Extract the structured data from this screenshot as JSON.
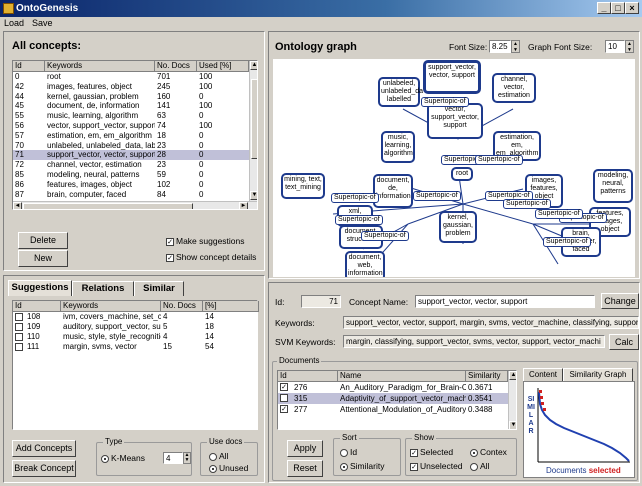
{
  "window": {
    "title": "OntoGenesis"
  },
  "menu": [
    "Load",
    "Save"
  ],
  "concepts_panel": {
    "title": "All concepts:",
    "columns": [
      "Id",
      "Keywords",
      "No. Docs",
      "Used [%]"
    ],
    "rows": [
      [
        "0",
        "root",
        "701",
        "100"
      ],
      [
        "42",
        "images, features, object",
        "245",
        "100"
      ],
      [
        "44",
        "kernel, gaussian, problem",
        "160",
        "0"
      ],
      [
        "45",
        "document, de, information",
        "141",
        "100"
      ],
      [
        "55",
        "music, learning, algorithm",
        "63",
        "0"
      ],
      [
        "56",
        "vector, support_vector, support",
        "74",
        "100"
      ],
      [
        "57",
        "estimation, em, em_algorithm",
        "18",
        "0"
      ],
      [
        "70",
        "unlabeled, unlabeled_data, labelled",
        "23",
        "0"
      ],
      [
        "71",
        "support_vector, vector, support",
        "28",
        "0"
      ],
      [
        "72",
        "channel, vector, estimation",
        "23",
        "0"
      ],
      [
        "85",
        "modeling, neural, patterns",
        "59",
        "0"
      ],
      [
        "86",
        "features, images, object",
        "102",
        "0"
      ],
      [
        "87",
        "brain, computer, faced",
        "84",
        "0"
      ]
    ],
    "selected_index": 8,
    "delete_label": "Delete",
    "new_label": "New",
    "make_suggestions": "Make suggestions",
    "show_details": "Show concept details"
  },
  "suggestions_panel": {
    "tabs": [
      "Suggestions",
      "Relations",
      "Similar"
    ],
    "columns": [
      "Id",
      "Keywords",
      "No. Docs",
      "[%]"
    ],
    "rows": [
      [
        "108",
        "ivm, covers_machine, set_co...",
        "4",
        "14"
      ],
      [
        "109",
        "auditory, support_vector, sup...",
        "5",
        "18"
      ],
      [
        "110",
        "music, style, style_recognition",
        "4",
        "14"
      ],
      [
        "111",
        "margin, svms, vector",
        "15",
        "54"
      ]
    ],
    "add_label": "Add Concepts",
    "break_label": "Break Concept",
    "type_title": "Type",
    "type_option": "K-Means",
    "k_value": "4",
    "use_docs_title": "Use docs",
    "use_all": "All",
    "use_unused": "Unused"
  },
  "graph": {
    "title": "Ontology graph",
    "font_size_label": "Font Size:",
    "font_size_value": "8.25",
    "graph_font_label": "Graph Font Size:",
    "graph_font_value": "10",
    "nodes": [
      {
        "text": "unlabeled, unlabeled_da labelled"
      },
      {
        "text": "support_vector, vector, support"
      },
      {
        "text": "channel, vector, estimation"
      },
      {
        "text": "vector, support_vector, support"
      },
      {
        "text": "music, learning, algorithm"
      },
      {
        "text": "estimation, em, em_algorithm"
      },
      {
        "text": "root"
      },
      {
        "text": "mining, text, text_mining"
      },
      {
        "text": "document, de, information"
      },
      {
        "text": "images, features, object"
      },
      {
        "text": "modeling, neural, patterns"
      },
      {
        "text": "xml, document"
      },
      {
        "text": "kernel, gaussian, problem"
      },
      {
        "text": "features, images, object"
      },
      {
        "text": "document, structural"
      },
      {
        "text": "brain, computer, faced"
      },
      {
        "text": "document, web, information"
      }
    ],
    "edge_label": "Supertopic-of"
  },
  "details": {
    "id_label": "Id:",
    "id_value": "71",
    "name_label": "Concept Name:",
    "name_value": "support_vector, vector, support",
    "change_label": "Change",
    "keywords_label": "Keywords:",
    "keywords_value": "support_vector, vector, support, margin, svms, vector_machine, classifying, suppor",
    "svm_label": "SVM Keywords:",
    "svm_value": "margin, classifying, support_vector, svms, vector, support, vector_machi",
    "calc_label": "Calc"
  },
  "documents": {
    "title": "Documents",
    "columns": [
      "Id",
      "Name",
      "Similarity"
    ],
    "rows": [
      {
        "checked": true,
        "id": "276",
        "name": "An_Auditory_Paradigm_for_Brain-C...",
        "sim": "0.3671"
      },
      {
        "checked": false,
        "id": "315",
        "name": "Adaptivity_of_support_vector_machi...",
        "sim": "0.3541"
      },
      {
        "checked": true,
        "id": "277",
        "name": "Attentional_Modulation_of_Auditory...",
        "sim": "0.3488"
      }
    ],
    "selected_index": 1,
    "apply_label": "Apply",
    "reset_label": "Reset",
    "sort_title": "Sort",
    "sort_id": "Id",
    "sort_similarity": "Similarity",
    "show_title": "Show",
    "show_selected": "Selected",
    "show_unselected": "Unselected",
    "show_context": "Contex",
    "show_all": "All"
  },
  "similarity": {
    "tabs": [
      "Content",
      "Similarity Graph"
    ],
    "vertical_label": "SIMILAR",
    "footer_text": "Documents",
    "footer_selected": "selected",
    "curve_color": "#2040b0",
    "marker_color": "#d02020"
  }
}
